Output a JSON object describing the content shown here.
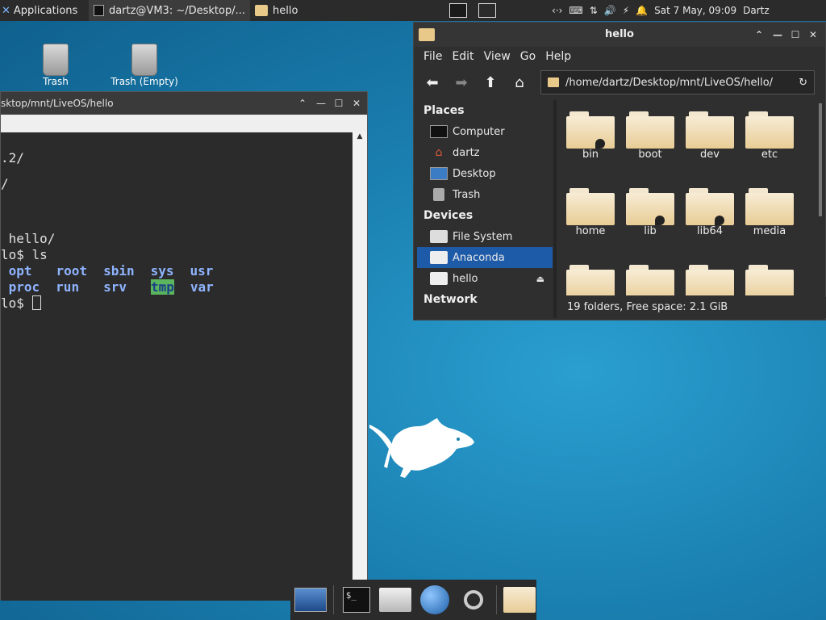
{
  "top_panel": {
    "applications_label": "Applications",
    "task_terminal": "dartz@VM3: ~/Desktop/...",
    "task_folder": "hello",
    "datetime": "Sat  7 May, 09:09",
    "user": "Dartz"
  },
  "desktop": {
    "icon1_label": "Trash",
    "icon2_label": "Trash (Empty)"
  },
  "terminal": {
    "title": "sktop/mnt/LiveOS/hello",
    "lines": {
      "l1": ".2/",
      "l2": "/",
      "l3": " hello/",
      "l4_prefix": "lo$ ",
      "l4_cmd": "ls",
      "r1": [
        " opt",
        "root",
        "sbin",
        "sys",
        "usr"
      ],
      "r2": [
        " proc",
        "run",
        "srv",
        "tmp",
        "var"
      ],
      "prompt": "lo$ "
    }
  },
  "file_manager": {
    "title": "hello",
    "menu": [
      "File",
      "Edit",
      "View",
      "Go",
      "Help"
    ],
    "path": "/home/dartz/Desktop/mnt/LiveOS/hello/",
    "sidebar": {
      "places_heading": "Places",
      "places": [
        "Computer",
        "dartz",
        "Desktop",
        "Trash"
      ],
      "devices_heading": "Devices",
      "devices": [
        "File System",
        "Anaconda",
        "hello"
      ],
      "network_heading": "Network"
    },
    "folders": [
      "bin",
      "boot",
      "dev",
      "etc",
      "home",
      "lib",
      "lib64",
      "media"
    ],
    "status": "19 folders, Free space: 2.1 GiB"
  }
}
